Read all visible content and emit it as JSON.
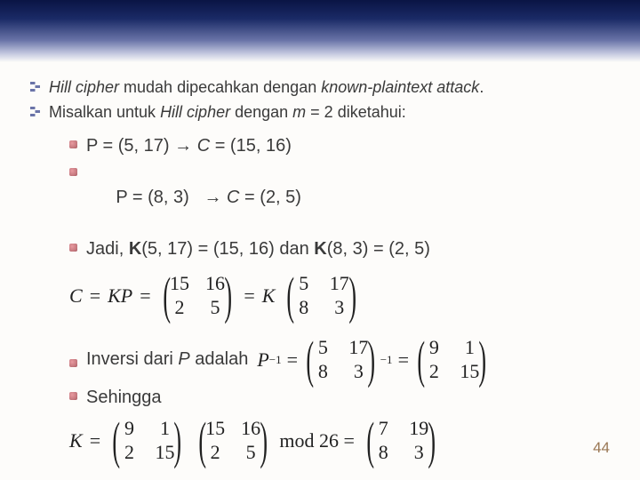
{
  "intro": {
    "line1_a": "Hill cipher",
    "line1_b": " mudah dipecahkan dengan ",
    "line1_c": "known-plaintext attack",
    "line1_d": ".",
    "line2_a": "Misalkan untuk ",
    "line2_b": "Hill cipher",
    "line2_c": " dengan ",
    "line2_d": "m",
    "line2_e": " = 2 diketahui:"
  },
  "items": {
    "p1": "P = (5, 17) → ",
    "p1c": "C",
    "p1v": " = (15, 16)",
    "p2": "P = (8, 3)   → ",
    "p2c": "C",
    "p2v": " = (2, 5)",
    "p3a": "Jadi, ",
    "p3b": "K",
    "p3c": "(5, 17) = (15, 16) dan ",
    "p3d": "K",
    "p3e": "(8, 3) = (2, 5)"
  },
  "eq1": {
    "lhs1": "C",
    "lhs2": " = ",
    "lhs3": "KP",
    "lhs4": " = ",
    "mC": [
      [
        "15",
        "16"
      ],
      [
        "2",
        "5"
      ]
    ],
    "mid": " = ",
    "k": "K",
    "mP": [
      [
        "5",
        "17"
      ],
      [
        "8",
        "3"
      ]
    ]
  },
  "inv": {
    "line1a": "Inversi dari ",
    "line1b": "P",
    "line1c": " adalah",
    "pinv": "P",
    "mP": [
      [
        "5",
        "17"
      ],
      [
        "8",
        "3"
      ]
    ],
    "mPinv": [
      [
        "9",
        "1"
      ],
      [
        "2",
        "15"
      ]
    ],
    "line2": "Sehingga"
  },
  "eq3": {
    "k": "K",
    "eq": " = ",
    "m1": [
      [
        "9",
        "1"
      ],
      [
        "2",
        "15"
      ]
    ],
    "m2": [
      [
        "15",
        "16"
      ],
      [
        "2",
        "5"
      ]
    ],
    "mod": " mod 26 = ",
    "m3": [
      [
        "7",
        "19"
      ],
      [
        "8",
        "3"
      ]
    ]
  },
  "page": "44"
}
